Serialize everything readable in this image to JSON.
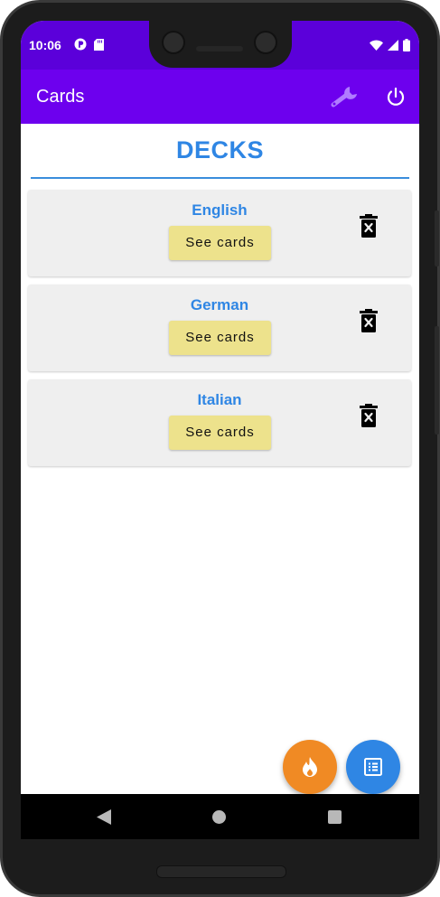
{
  "status_bar": {
    "time": "10:06",
    "color": "#5b00da"
  },
  "app_bar": {
    "title": "Cards",
    "color": "#6d00ee",
    "actions": [
      "wrench-icon",
      "power-icon"
    ]
  },
  "main": {
    "heading": "DECKS",
    "accent_color": "#2f86e4",
    "decks": [
      {
        "name": "English",
        "button_label": "See cards"
      },
      {
        "name": "German",
        "button_label": "See cards"
      },
      {
        "name": "Italian",
        "button_label": "See cards"
      }
    ]
  },
  "fabs": [
    {
      "icon": "fire-icon",
      "color": "#f08a24"
    },
    {
      "icon": "list-icon",
      "color": "#2f86e4"
    }
  ],
  "nav_bar": {
    "buttons": [
      "back-icon",
      "home-icon",
      "recents-icon"
    ]
  }
}
